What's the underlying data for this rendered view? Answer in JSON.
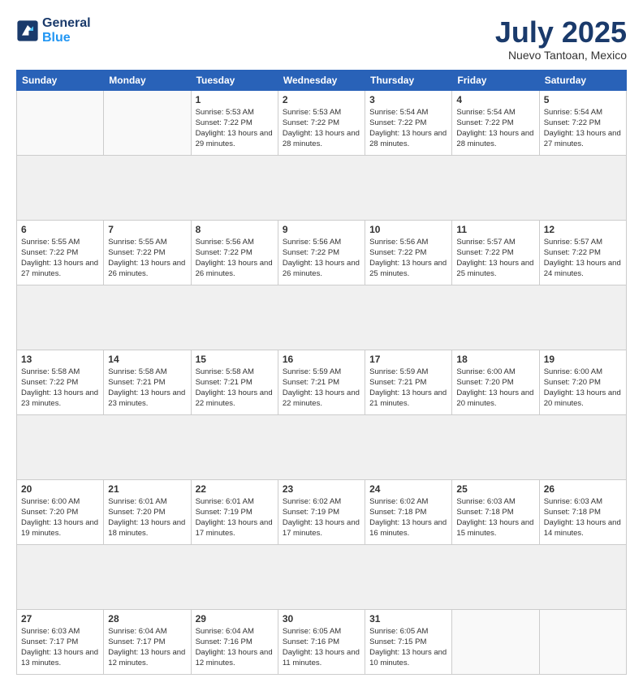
{
  "header": {
    "logo_line1": "General",
    "logo_line2": "Blue",
    "month_year": "July 2025",
    "location": "Nuevo Tantoan, Mexico"
  },
  "weekdays": [
    "Sunday",
    "Monday",
    "Tuesday",
    "Wednesday",
    "Thursday",
    "Friday",
    "Saturday"
  ],
  "weeks": [
    [
      {
        "day": "",
        "info": ""
      },
      {
        "day": "",
        "info": ""
      },
      {
        "day": "1",
        "info": "Sunrise: 5:53 AM\nSunset: 7:22 PM\nDaylight: 13 hours\nand 29 minutes."
      },
      {
        "day": "2",
        "info": "Sunrise: 5:53 AM\nSunset: 7:22 PM\nDaylight: 13 hours\nand 28 minutes."
      },
      {
        "day": "3",
        "info": "Sunrise: 5:54 AM\nSunset: 7:22 PM\nDaylight: 13 hours\nand 28 minutes."
      },
      {
        "day": "4",
        "info": "Sunrise: 5:54 AM\nSunset: 7:22 PM\nDaylight: 13 hours\nand 28 minutes."
      },
      {
        "day": "5",
        "info": "Sunrise: 5:54 AM\nSunset: 7:22 PM\nDaylight: 13 hours\nand 27 minutes."
      }
    ],
    [
      {
        "day": "6",
        "info": "Sunrise: 5:55 AM\nSunset: 7:22 PM\nDaylight: 13 hours\nand 27 minutes."
      },
      {
        "day": "7",
        "info": "Sunrise: 5:55 AM\nSunset: 7:22 PM\nDaylight: 13 hours\nand 26 minutes."
      },
      {
        "day": "8",
        "info": "Sunrise: 5:56 AM\nSunset: 7:22 PM\nDaylight: 13 hours\nand 26 minutes."
      },
      {
        "day": "9",
        "info": "Sunrise: 5:56 AM\nSunset: 7:22 PM\nDaylight: 13 hours\nand 26 minutes."
      },
      {
        "day": "10",
        "info": "Sunrise: 5:56 AM\nSunset: 7:22 PM\nDaylight: 13 hours\nand 25 minutes."
      },
      {
        "day": "11",
        "info": "Sunrise: 5:57 AM\nSunset: 7:22 PM\nDaylight: 13 hours\nand 25 minutes."
      },
      {
        "day": "12",
        "info": "Sunrise: 5:57 AM\nSunset: 7:22 PM\nDaylight: 13 hours\nand 24 minutes."
      }
    ],
    [
      {
        "day": "13",
        "info": "Sunrise: 5:58 AM\nSunset: 7:22 PM\nDaylight: 13 hours\nand 23 minutes."
      },
      {
        "day": "14",
        "info": "Sunrise: 5:58 AM\nSunset: 7:21 PM\nDaylight: 13 hours\nand 23 minutes."
      },
      {
        "day": "15",
        "info": "Sunrise: 5:58 AM\nSunset: 7:21 PM\nDaylight: 13 hours\nand 22 minutes."
      },
      {
        "day": "16",
        "info": "Sunrise: 5:59 AM\nSunset: 7:21 PM\nDaylight: 13 hours\nand 22 minutes."
      },
      {
        "day": "17",
        "info": "Sunrise: 5:59 AM\nSunset: 7:21 PM\nDaylight: 13 hours\nand 21 minutes."
      },
      {
        "day": "18",
        "info": "Sunrise: 6:00 AM\nSunset: 7:20 PM\nDaylight: 13 hours\nand 20 minutes."
      },
      {
        "day": "19",
        "info": "Sunrise: 6:00 AM\nSunset: 7:20 PM\nDaylight: 13 hours\nand 20 minutes."
      }
    ],
    [
      {
        "day": "20",
        "info": "Sunrise: 6:00 AM\nSunset: 7:20 PM\nDaylight: 13 hours\nand 19 minutes."
      },
      {
        "day": "21",
        "info": "Sunrise: 6:01 AM\nSunset: 7:20 PM\nDaylight: 13 hours\nand 18 minutes."
      },
      {
        "day": "22",
        "info": "Sunrise: 6:01 AM\nSunset: 7:19 PM\nDaylight: 13 hours\nand 17 minutes."
      },
      {
        "day": "23",
        "info": "Sunrise: 6:02 AM\nSunset: 7:19 PM\nDaylight: 13 hours\nand 17 minutes."
      },
      {
        "day": "24",
        "info": "Sunrise: 6:02 AM\nSunset: 7:18 PM\nDaylight: 13 hours\nand 16 minutes."
      },
      {
        "day": "25",
        "info": "Sunrise: 6:03 AM\nSunset: 7:18 PM\nDaylight: 13 hours\nand 15 minutes."
      },
      {
        "day": "26",
        "info": "Sunrise: 6:03 AM\nSunset: 7:18 PM\nDaylight: 13 hours\nand 14 minutes."
      }
    ],
    [
      {
        "day": "27",
        "info": "Sunrise: 6:03 AM\nSunset: 7:17 PM\nDaylight: 13 hours\nand 13 minutes."
      },
      {
        "day": "28",
        "info": "Sunrise: 6:04 AM\nSunset: 7:17 PM\nDaylight: 13 hours\nand 12 minutes."
      },
      {
        "day": "29",
        "info": "Sunrise: 6:04 AM\nSunset: 7:16 PM\nDaylight: 13 hours\nand 12 minutes."
      },
      {
        "day": "30",
        "info": "Sunrise: 6:05 AM\nSunset: 7:16 PM\nDaylight: 13 hours\nand 11 minutes."
      },
      {
        "day": "31",
        "info": "Sunrise: 6:05 AM\nSunset: 7:15 PM\nDaylight: 13 hours\nand 10 minutes."
      },
      {
        "day": "",
        "info": ""
      },
      {
        "day": "",
        "info": ""
      }
    ]
  ]
}
